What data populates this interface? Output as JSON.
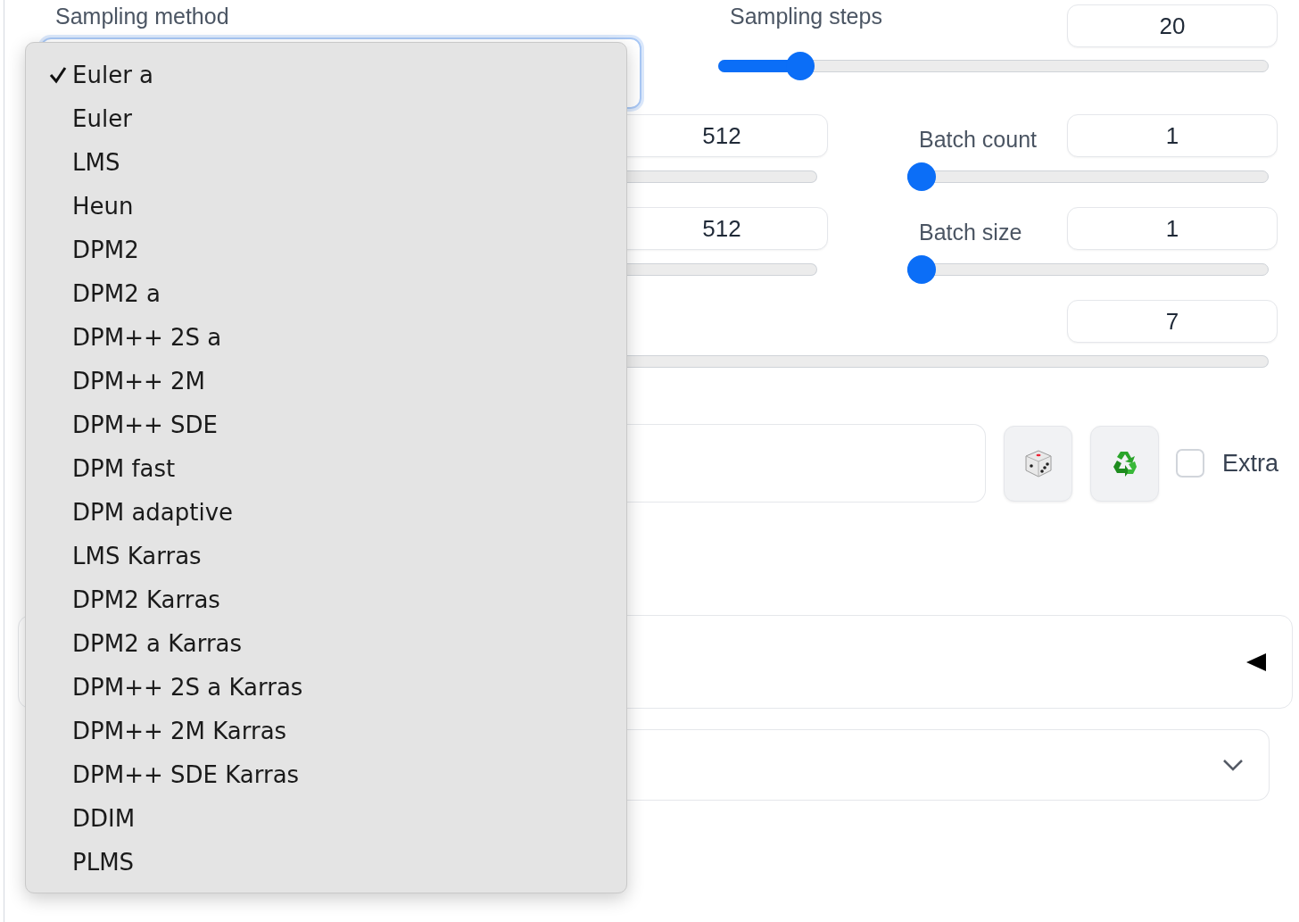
{
  "sampling_method": {
    "label": "Sampling method",
    "options": [
      {
        "label": "Euler a",
        "selected": true
      },
      {
        "label": "Euler",
        "selected": false
      },
      {
        "label": "LMS",
        "selected": false
      },
      {
        "label": "Heun",
        "selected": false
      },
      {
        "label": "DPM2",
        "selected": false
      },
      {
        "label": "DPM2 a",
        "selected": false
      },
      {
        "label": "DPM++ 2S a",
        "selected": false
      },
      {
        "label": "DPM++ 2M",
        "selected": false
      },
      {
        "label": "DPM++ SDE",
        "selected": false
      },
      {
        "label": "DPM fast",
        "selected": false
      },
      {
        "label": "DPM adaptive",
        "selected": false
      },
      {
        "label": "LMS Karras",
        "selected": false
      },
      {
        "label": "DPM2 Karras",
        "selected": false
      },
      {
        "label": "DPM2 a Karras",
        "selected": false
      },
      {
        "label": "DPM++ 2S a Karras",
        "selected": false
      },
      {
        "label": "DPM++ 2M Karras",
        "selected": false
      },
      {
        "label": "DPM++ SDE Karras",
        "selected": false
      },
      {
        "label": "DDIM",
        "selected": false
      },
      {
        "label": "PLMS",
        "selected": false
      }
    ]
  },
  "sampling_steps": {
    "label": "Sampling steps",
    "value": "20",
    "level": 0.13
  },
  "slider_rows": [
    {
      "left_value": "512",
      "label": "Batch count",
      "value": "1",
      "level": 0
    },
    {
      "left_value": "512",
      "label": "Batch size",
      "value": "1",
      "level": 0
    }
  ],
  "wide_slider": {
    "value": "7"
  },
  "seed_row": {
    "extra": {
      "label": "Extra",
      "checked": false
    }
  }
}
